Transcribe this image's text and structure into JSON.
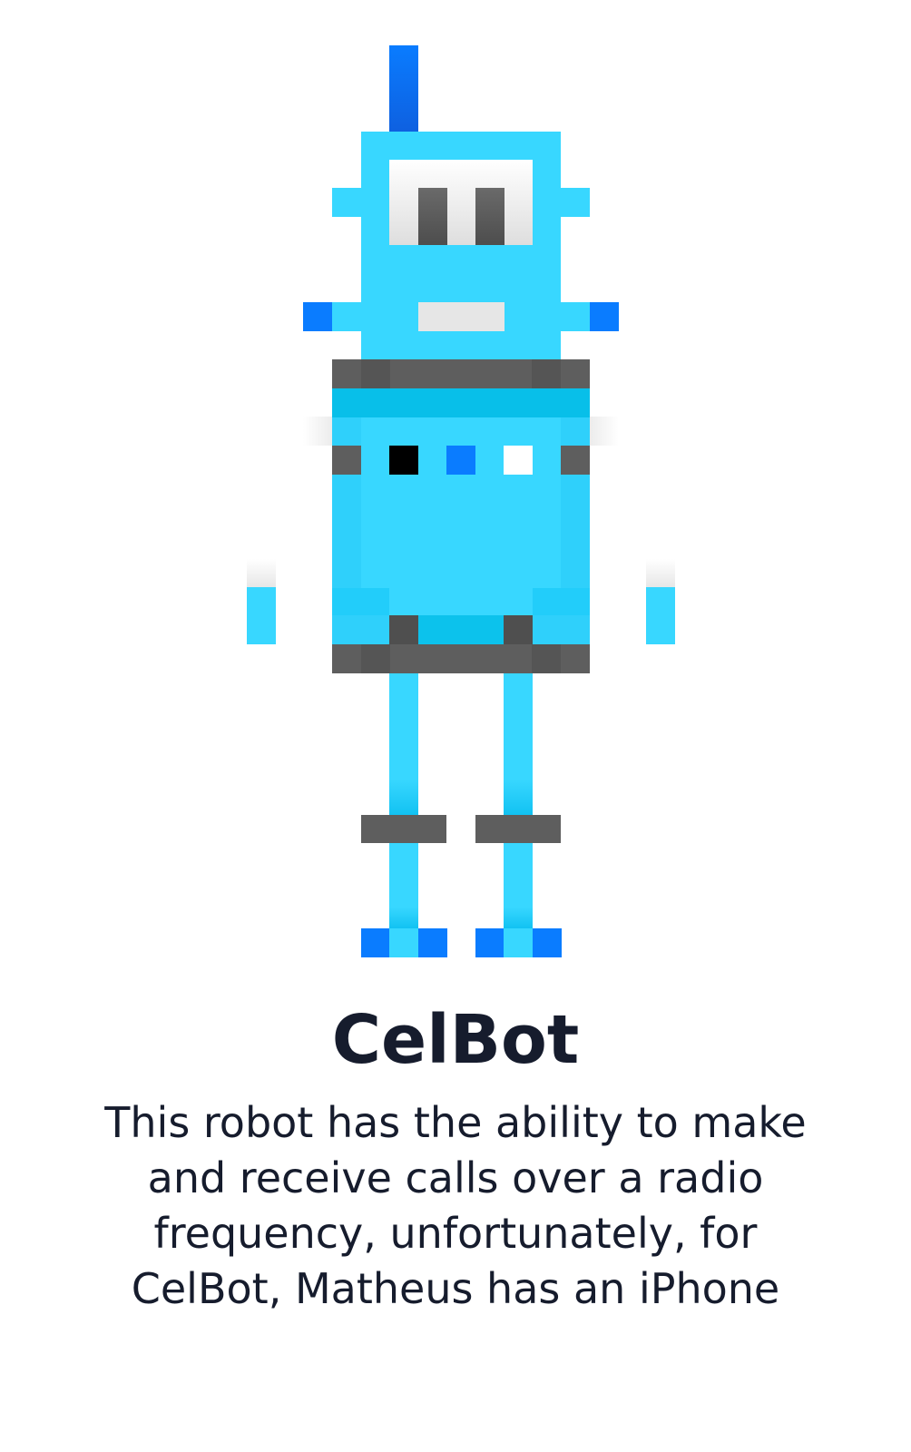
{
  "robot": {
    "name": "CelBot",
    "description": "This robot has the ability to make and receive calls over a radio frequency, unfortunately, for CelBot, Matheus has an iPhone"
  },
  "colors": {
    "body_light": "#38d7ff",
    "body_mid": "#06c0ea",
    "accent_blue": "#0a7cff",
    "dark_gray": "#5e5e5e",
    "text_dark": "#161c2d"
  }
}
